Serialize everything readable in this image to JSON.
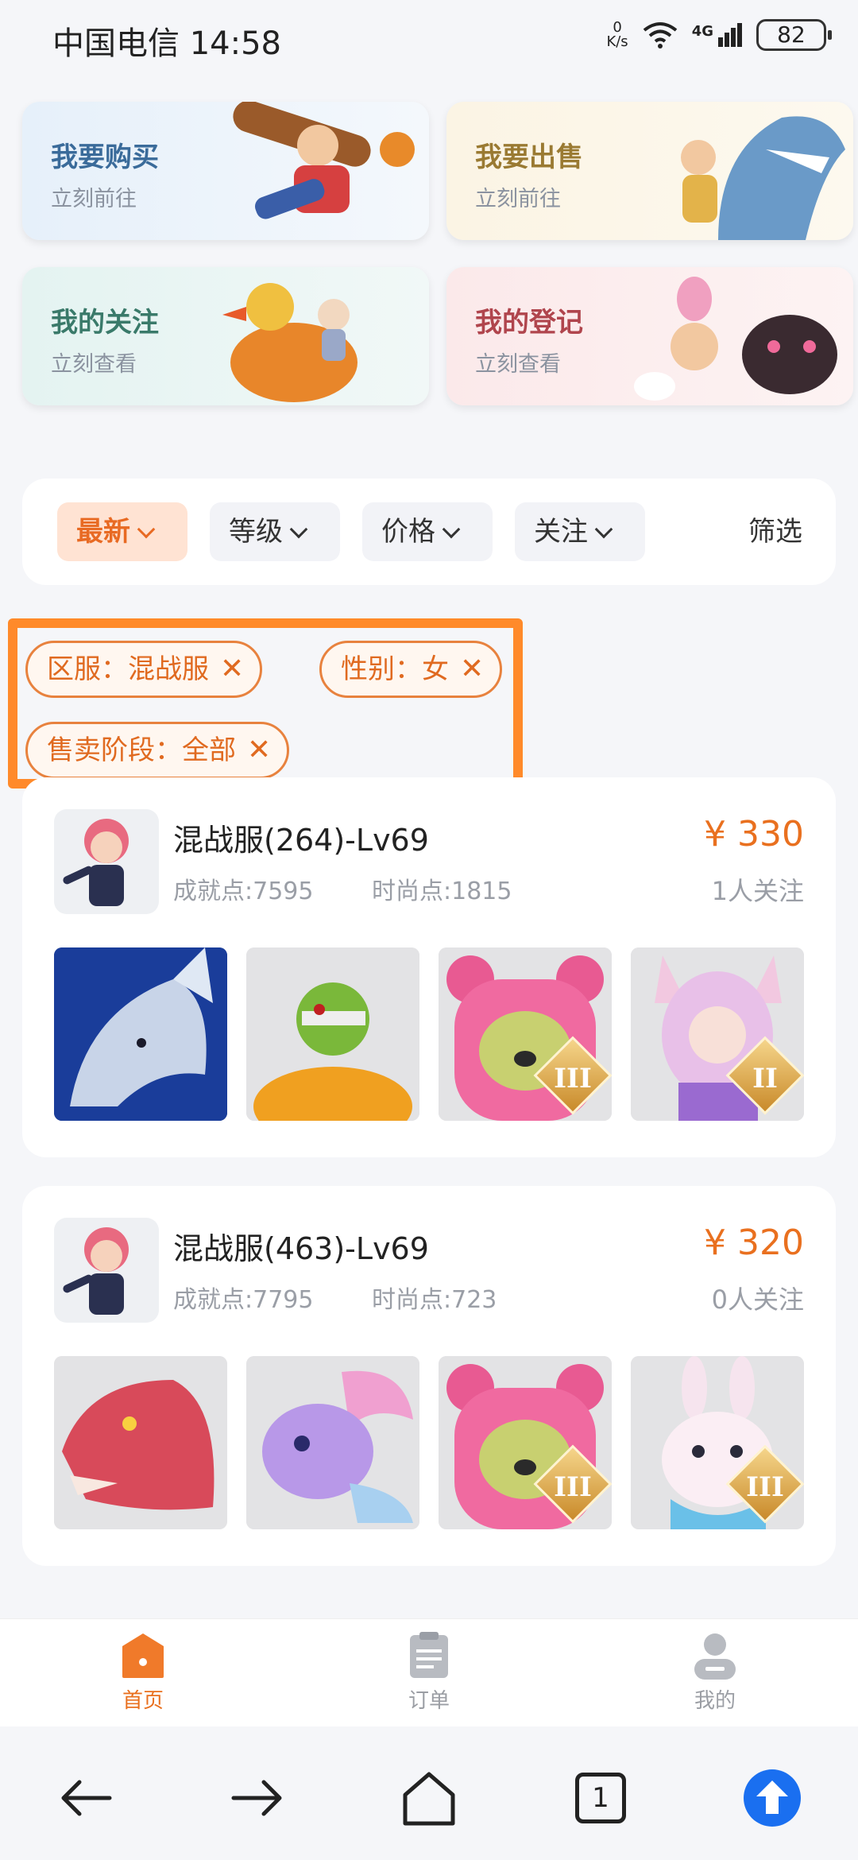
{
  "status_bar": {
    "carrier_time": "中国电信 14:58",
    "net_speed_value": "0",
    "net_speed_unit": "K/s",
    "network": "4G",
    "battery": "82"
  },
  "quick_cards": [
    {
      "title": "我要购买",
      "subtitle": "立刻前往"
    },
    {
      "title": "我要出售",
      "subtitle": "立刻前往"
    },
    {
      "title": "我的关注",
      "subtitle": "立刻查看"
    },
    {
      "title": "我的登记",
      "subtitle": "立刻查看"
    }
  ],
  "sort_bar": {
    "options": [
      "最新",
      "等级",
      "价格",
      "关注"
    ],
    "active": "最新",
    "filter_label": "筛选"
  },
  "filter_tags": [
    "区服：混战服",
    "性别：女",
    "售卖阶段：全部"
  ],
  "listings": [
    {
      "title": "混战服(264)-Lv69",
      "achievement": "成就点:7595",
      "fashion": "时尚点:1815",
      "price": "¥ 330",
      "follow": "1人关注",
      "thumbs": [
        {
          "icon": "blue-wolf-icon",
          "tier": ""
        },
        {
          "icon": "zombie-pumpkin-icon",
          "tier": ""
        },
        {
          "icon": "pink-bear-icon",
          "tier": "III"
        },
        {
          "icon": "fox-girl-icon",
          "tier": "II"
        }
      ]
    },
    {
      "title": "混战服(463)-Lv69",
      "achievement": "成就点:7795",
      "fashion": "时尚点:723",
      "price": "¥ 320",
      "follow": "0人关注",
      "thumbs": [
        {
          "icon": "red-dragon-icon",
          "tier": ""
        },
        {
          "icon": "purple-dragon-icon",
          "tier": ""
        },
        {
          "icon": "pink-bear-icon",
          "tier": "III"
        },
        {
          "icon": "bunny-icon",
          "tier": "III"
        }
      ]
    }
  ],
  "tab_bar": [
    {
      "label": "首页",
      "icon": "home-icon",
      "active": true
    },
    {
      "label": "订单",
      "icon": "orders-icon",
      "active": false
    },
    {
      "label": "我的",
      "icon": "profile-icon",
      "active": false
    }
  ],
  "system_nav": {
    "tab_count": "1"
  },
  "colors": {
    "accent": "#e9701f",
    "highlight_border": "#ff8a2a"
  }
}
